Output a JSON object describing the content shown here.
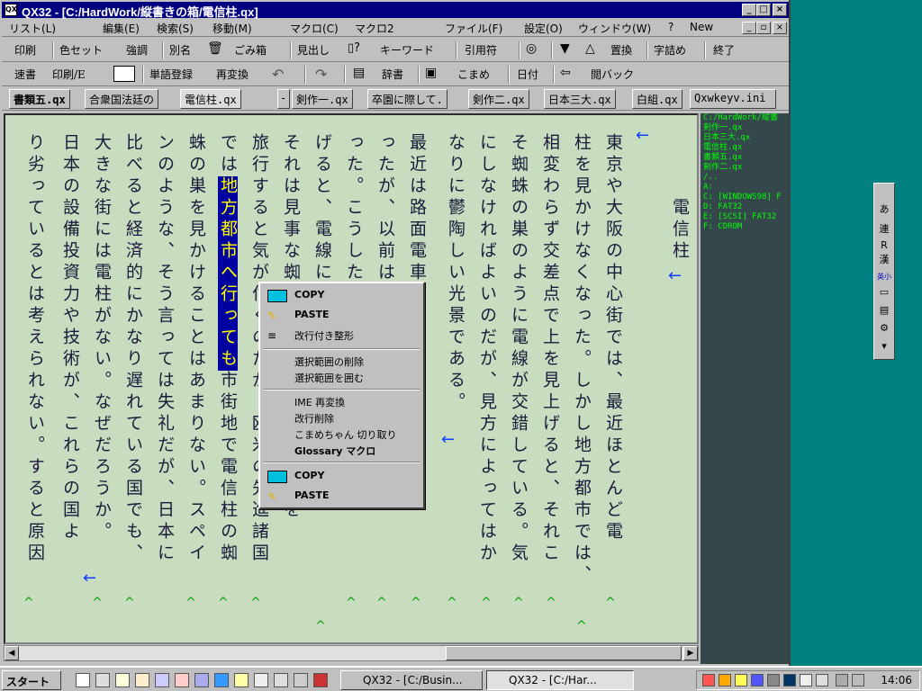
{
  "window": {
    "title": "QX32 - [C:/HardWork/縦書きの箱/電信柱.qx]",
    "icon": "qx-app-icon",
    "controls": {
      "minimize": "_",
      "maximize": "□",
      "close": "×"
    }
  },
  "menu": [
    "リスト(L)",
    "編集(E)",
    "検索(S)",
    "移動(M)",
    "マクロ(C)",
    "マクロ2",
    "ファイル(F)",
    "設定(O)",
    "ウィンドウ(W)",
    "?",
    "New"
  ],
  "toolbar1": [
    "印刷",
    "色セット",
    "強調",
    "別名",
    "ごみ箱",
    "見出し",
    "キーワード",
    "引用符",
    "置換",
    "字詰め",
    "終了"
  ],
  "toolbar2": [
    "速書",
    "印刷/E",
    "単語登録",
    "再変換",
    "辞書",
    "こまめ",
    "日付",
    "閲バック"
  ],
  "tabs": [
    "書類五.qx",
    "合衆国法廷の",
    "電信柱.qx",
    "剣作一.qx",
    "卒園に際して.",
    "剣作二.qx",
    "日本三大.qx",
    "白組.qx",
    "Qxwkeyv.ini"
  ],
  "document": {
    "title": "電信柱",
    "columns": [
      "東京や大阪の中心街では、最近ほとんど電",
      "柱を見かけなくなった。しかし地方都市では、",
      "相変わらず交差点で上を見上げると、それこ",
      "そ蜘蛛の巣のように電線が交錯している。気",
      "にしなければよいのだが、見方によってはか",
      "なりに鬱陶しい光景である。",
      "最近は路面電車が、少なくな",
      "ったが、以前は",
      "った。こうした",
      "げると、電線に加わって、空を見上",
      "それは見事な蜘蛛の巣である。し海外を",
      "旅行すると気が付くのだが、欧米の先進諸国",
      "では地方都市へ行っても市街地で電信柱の蜘",
      "蛛の巣を見かけることはあまりない。スペイ",
      "ンのような、そう言っては失礼だが、日本に",
      "比べると経済的にかなり遅れている国でも、",
      "大きな街には電柱がない。なぜだろうか。",
      "日本の設備投資力や技術が、これらの国よ",
      "り劣っているとは考えられない。すると原因"
    ],
    "highlight": "地方都市へ行っても"
  },
  "sidepane": [
    "C:/HardWork/縦書",
    "剣作一.qx",
    "日本三大.qx",
    "電信柱.qx",
    "書類五.qx",
    "剣作二.qx",
    "/..",
    "A:",
    "C: [WINDOWS98] F",
    "D: FAT32",
    "E: [SCSI] FAT32",
    "F: CDROM"
  ],
  "context_menu": {
    "items": [
      "COPY",
      "PASTE",
      "改行付き整形",
      "選択範囲の削除",
      "選択範囲を囲む",
      "IME 再変換",
      "改行削除",
      "こまめちゃん 切り取り",
      "Glossary マクロ",
      "COPY",
      "PASTE"
    ]
  },
  "ime_bar": [
    "あ",
    "連",
    "R",
    "漢",
    "英小"
  ],
  "taskbar": {
    "start": "スタート",
    "tasks": [
      "QX32 - [C:/Busin...",
      "QX32 - [C:/Har..."
    ],
    "clock": "14:06"
  },
  "colors": {
    "titlebar": "#000080",
    "editor_bg": "#c8dcc0",
    "highlight_bg": "#0000a0",
    "highlight_fg": "#ffff00",
    "sidepane_bg": "#34484c",
    "sidepane_fg": "#00ff00"
  }
}
